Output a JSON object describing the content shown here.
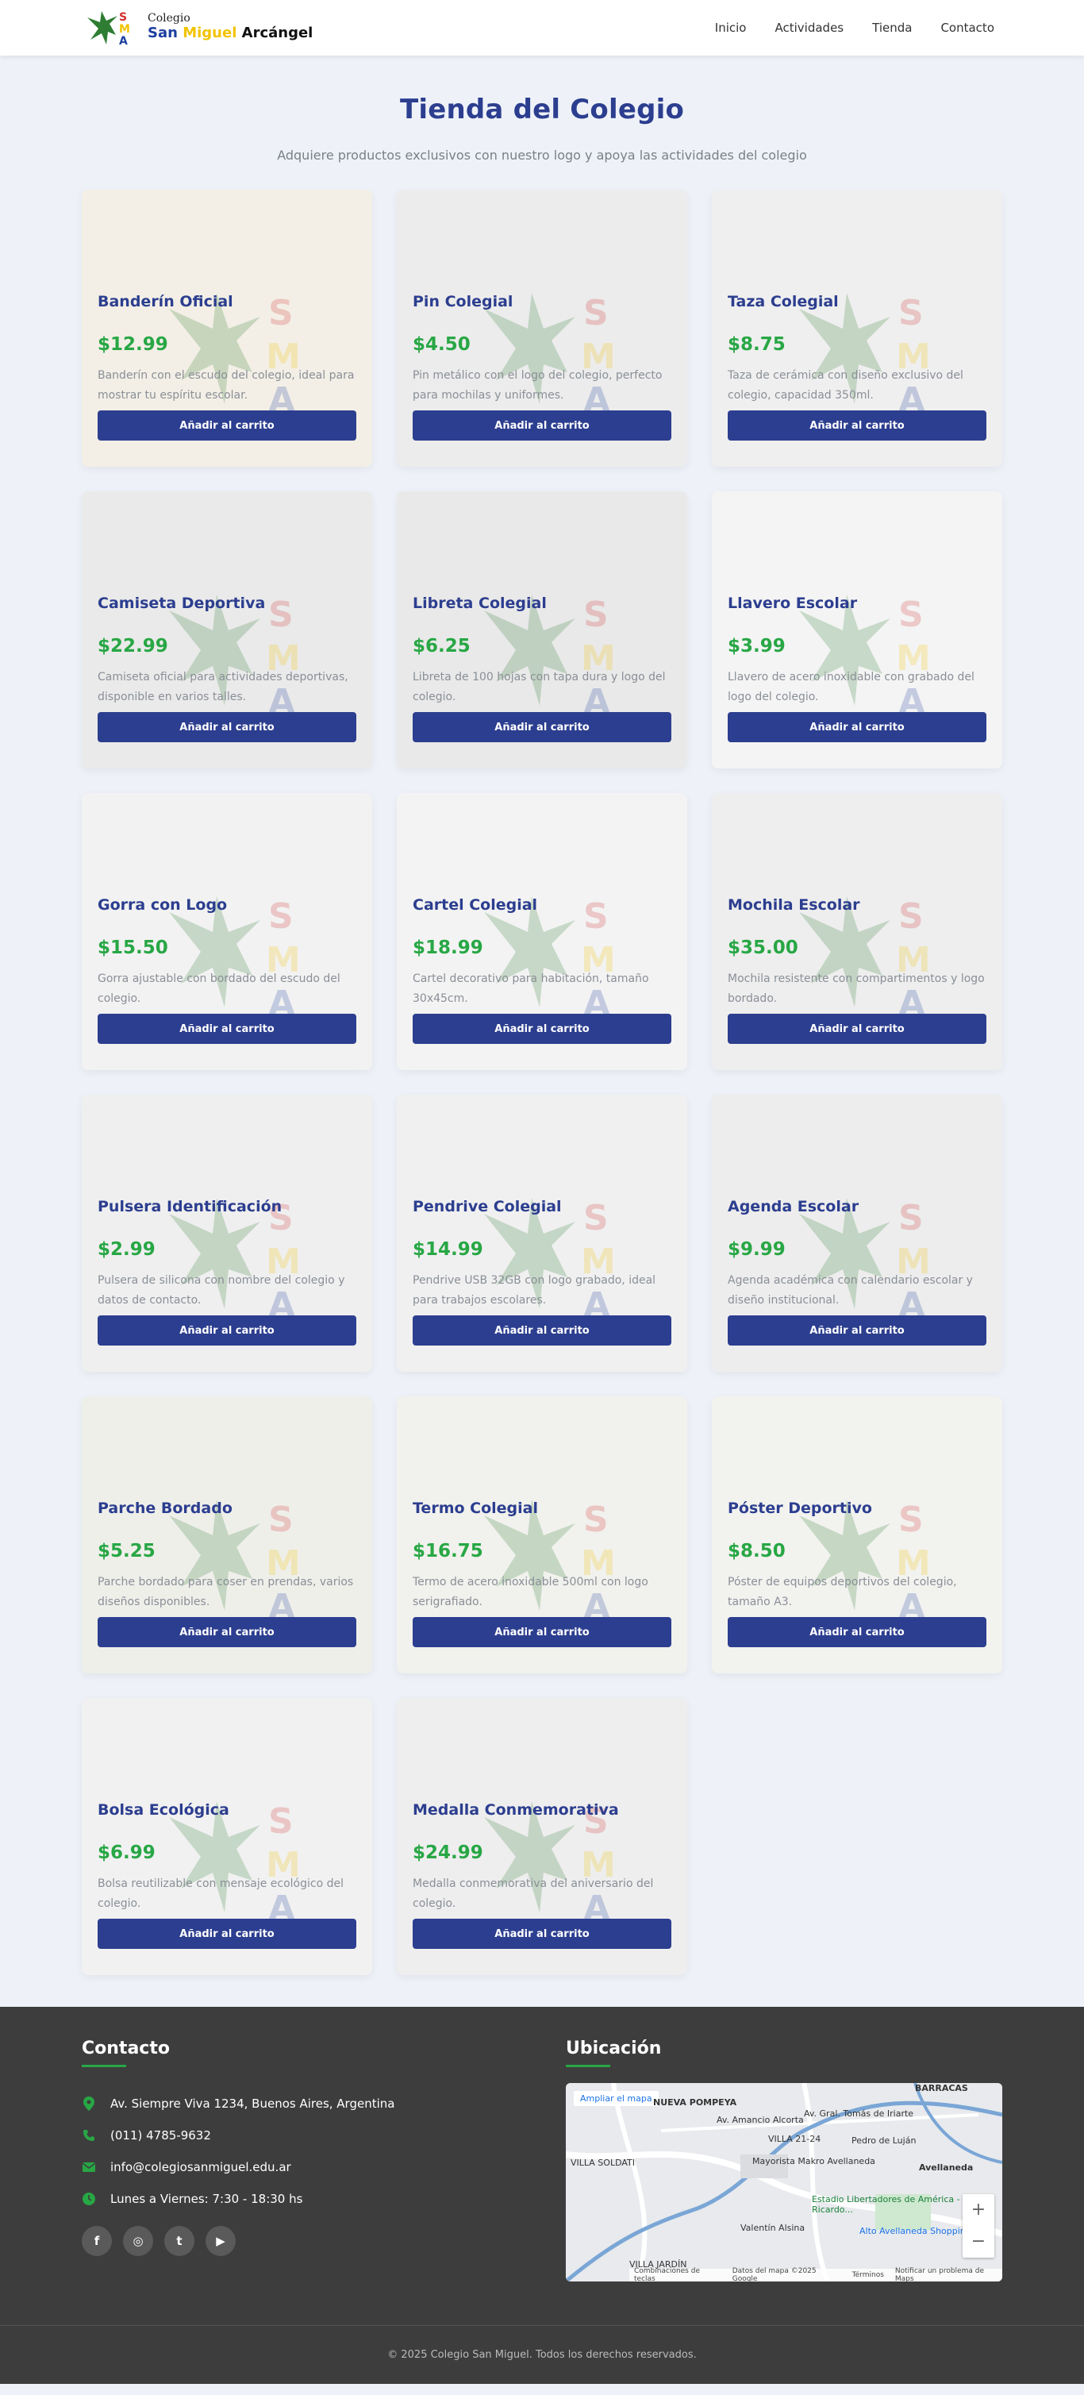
{
  "header": {
    "logo_small": "Colegio",
    "logo_big_s": "San ",
    "logo_big_m": "Miguel ",
    "logo_big_a": "Arcángel",
    "nav": [
      {
        "label": "Inicio"
      },
      {
        "label": "Actividades"
      },
      {
        "label": "Tienda"
      },
      {
        "label": "Contacto"
      }
    ]
  },
  "main": {
    "title": "Tienda del Colegio",
    "subtitle": "Adquiere productos exclusivos con nuestro logo y apoya las actividades del colegio",
    "button_label": "Añadir al carrito",
    "products": [
      {
        "name": "Banderín Oficial",
        "price": "$12.99",
        "desc": "Banderín con el escudo del colegio, ideal para mostrar tu espíritu escolar."
      },
      {
        "name": "Pin Colegial",
        "price": "$4.50",
        "desc": "Pin metálico con el logo del colegio, perfecto para mochilas y uniformes."
      },
      {
        "name": "Taza Colegial",
        "price": "$8.75",
        "desc": "Taza de cerámica con diseño exclusivo del colegio, capacidad 350ml."
      },
      {
        "name": "Camiseta Deportiva",
        "price": "$22.99",
        "desc": "Camiseta oficial para actividades deportivas, disponible en varios talles."
      },
      {
        "name": "Libreta Colegial",
        "price": "$6.25",
        "desc": "Libreta de 100 hojas con tapa dura y logo del colegio."
      },
      {
        "name": "Llavero Escolar",
        "price": "$3.99",
        "desc": "Llavero de acero inoxidable con grabado del logo del colegio."
      },
      {
        "name": "Gorra con Logo",
        "price": "$15.50",
        "desc": "Gorra ajustable con bordado del escudo del colegio."
      },
      {
        "name": "Cartel Colegial",
        "price": "$18.99",
        "desc": "Cartel decorativo para habitación, tamaño 30x45cm."
      },
      {
        "name": "Mochila Escolar",
        "price": "$35.00",
        "desc": "Mochila resistente con compartimentos y logo bordado."
      },
      {
        "name": "Pulsera Identificación",
        "price": "$2.99",
        "desc": "Pulsera de silicona con nombre del colegio y datos de contacto."
      },
      {
        "name": "Pendrive Colegial",
        "price": "$14.99",
        "desc": "Pendrive USB 32GB con logo grabado, ideal para trabajos escolares."
      },
      {
        "name": "Agenda Escolar",
        "price": "$9.99",
        "desc": "Agenda académica con calendario escolar y diseño institucional."
      },
      {
        "name": "Parche Bordado",
        "price": "$5.25",
        "desc": "Parche bordado para coser en prendas, varios diseños disponibles."
      },
      {
        "name": "Termo Colegial",
        "price": "$16.75",
        "desc": "Termo de acero inoxidable 500ml con logo serigrafiado."
      },
      {
        "name": "Póster Deportivo",
        "price": "$8.50",
        "desc": "Póster de equipos deportivos del colegio, tamaño A3."
      },
      {
        "name": "Bolsa Ecológica",
        "price": "$6.99",
        "desc": "Bolsa reutilizable con mensaje ecológico del colegio."
      },
      {
        "name": "Medalla Conmemorativa",
        "price": "$24.99",
        "desc": "Medalla conmemorativa del aniversario del colegio."
      }
    ]
  },
  "footer": {
    "contact_title": "Contacto",
    "location_title": "Ubicación",
    "address": "Av. Siempre Viva 1234, Buenos Aires, Argentina",
    "phone": "(011) 4785-9632",
    "email": "info@colegiosanmiguel.edu.ar",
    "hours": "Lunes a Viernes: 7:30 - 18:30 hs",
    "socials": [
      "f",
      "◎",
      "t",
      "▶"
    ],
    "map": {
      "link": "Ampliar el mapa",
      "labels": [
        "NUEVA POMPEYA",
        "VILLA 21-24",
        "Mayorista Makro Avellaneda",
        "Avellaneda",
        "Estadio Libertadores de América - Ricardo...",
        "Alto Avellaneda Shopping",
        "Valentín Alsina",
        "VILLA SOLDATI",
        "VILLA JARDÍN",
        "Pedro de Luján",
        "BARRACAS",
        "Av. Gral. Tomás de Iriarte",
        "Av. Amancio Alcorta"
      ],
      "attrib": [
        "Combinaciones de teclas",
        "Datos del mapa ©2025 Google",
        "Términos",
        "Notificar un problema de Maps"
      ]
    },
    "copyright": "© 2025 Colegio San Miguel. Todos los derechos reservados."
  }
}
